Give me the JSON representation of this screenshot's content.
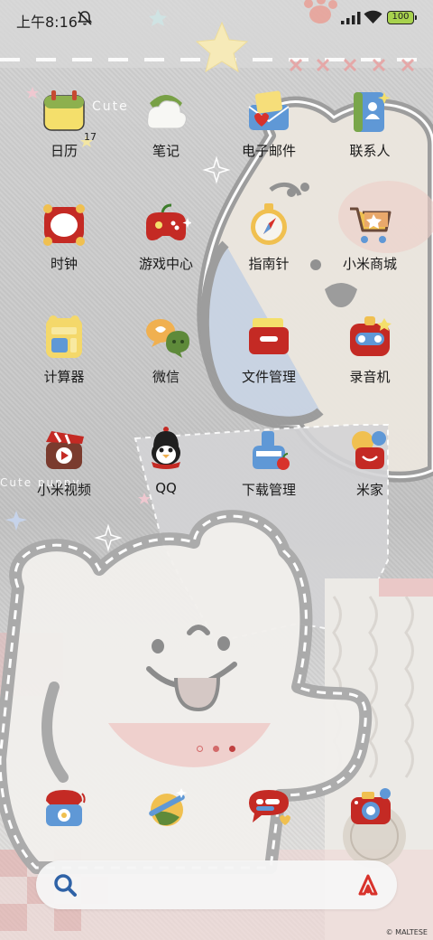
{
  "status_bar": {
    "time": "上午8:16",
    "battery": "100"
  },
  "wallpaper": {
    "text_1": "Cute",
    "text_2": "Cute puppy"
  },
  "apps": [
    {
      "label": "日历",
      "icon": "calendar-icon"
    },
    {
      "label": "笔记",
      "icon": "notes-icon"
    },
    {
      "label": "电子邮件",
      "icon": "email-icon"
    },
    {
      "label": "联系人",
      "icon": "contacts-icon"
    },
    {
      "label": "时钟",
      "icon": "clock-icon"
    },
    {
      "label": "游戏中心",
      "icon": "game-center-icon"
    },
    {
      "label": "指南针",
      "icon": "compass-icon"
    },
    {
      "label": "小米商城",
      "icon": "mi-store-icon"
    },
    {
      "label": "计算器",
      "icon": "calculator-icon"
    },
    {
      "label": "微信",
      "icon": "wechat-icon"
    },
    {
      "label": "文件管理",
      "icon": "file-manager-icon"
    },
    {
      "label": "录音机",
      "icon": "recorder-icon"
    },
    {
      "label": "小米视频",
      "icon": "mi-video-icon"
    },
    {
      "label": "QQ",
      "icon": "qq-icon"
    },
    {
      "label": "下载管理",
      "icon": "downloads-icon"
    },
    {
      "label": "米家",
      "icon": "mi-home-icon"
    }
  ],
  "calendar_date": "17",
  "dock": [
    {
      "icon": "phone-icon"
    },
    {
      "icon": "browser-icon"
    },
    {
      "icon": "messages-icon"
    },
    {
      "icon": "camera-icon"
    }
  ],
  "page_indicator": {
    "count": 3,
    "active": 1
  },
  "watermark": "© MALTESE"
}
